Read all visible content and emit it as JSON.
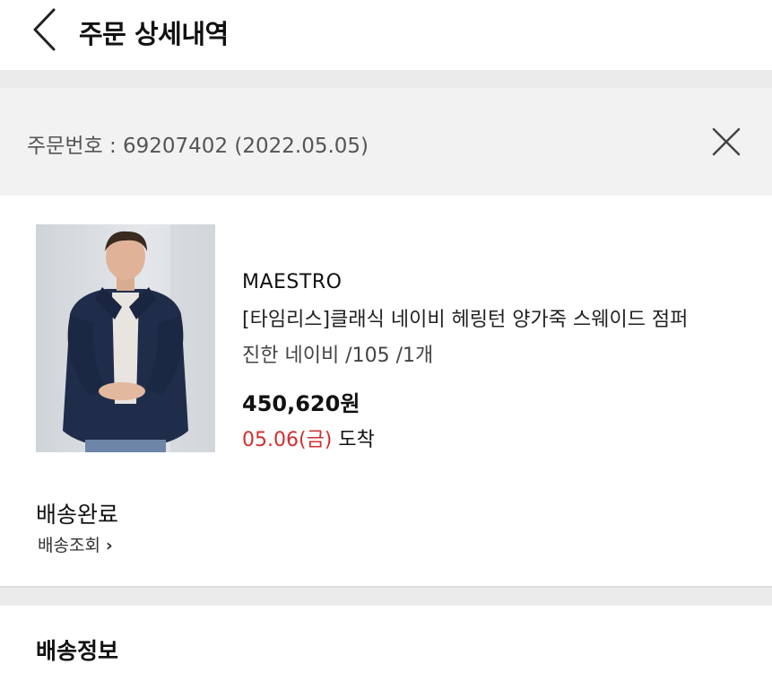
{
  "header": {
    "title": "주문 상세내역"
  },
  "order": {
    "number_text": "주문번호 : 69207402 (2022.05.05)"
  },
  "product": {
    "brand": "MAESTRO",
    "name": "[타임리스]클래식 네이비 헤링턴 양가죽 스웨이드 점퍼",
    "option": "진한 네이비 /105 /1개",
    "price": "450,620원",
    "arrival_date": "05.06(금)",
    "arrival_suffix": " 도착"
  },
  "delivery": {
    "status": "배송완료",
    "track_label": "배송조회"
  },
  "section2": {
    "title": "배송정보"
  },
  "colors": {
    "accent_red": "#d32f2f",
    "gap_gray": "#ebebeb"
  }
}
